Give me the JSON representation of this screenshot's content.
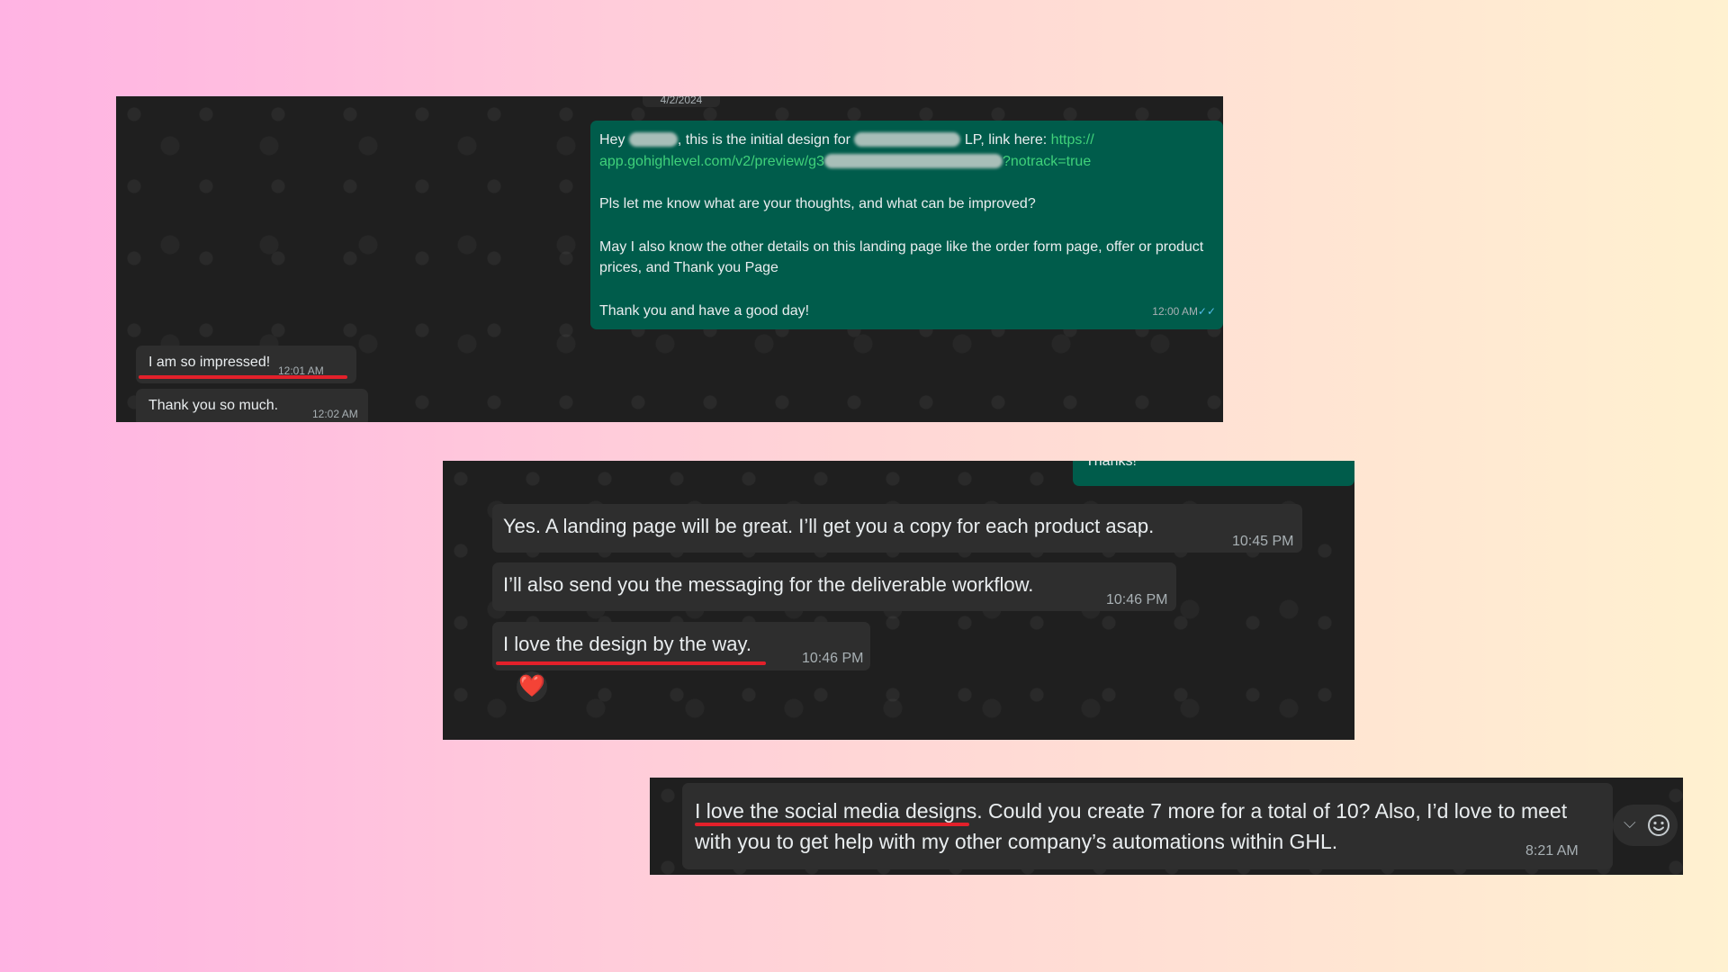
{
  "chat1": {
    "date": "4/2/2024",
    "outgoing": {
      "line1_prefix": "Hey ",
      "line1_mid": ", this is the initial design for ",
      "line1_suffix": " LP, link here: ",
      "link_start": "https://",
      "link_domain": "app.gohighlevel.com/v2/preview/g3",
      "link_end": "?notrack=true",
      "para2": "Pls let me know what are your thoughts, and what can be improved?",
      "para3": "May I also know the other details on this landing page like the order form page, offer or product prices, and Thank you Page",
      "para4": "Thank you and have a good day!",
      "time": "12:00 AM",
      "ticks": "✓✓"
    },
    "incoming": [
      {
        "text": "I am so impressed!",
        "time": "12:01 AM"
      },
      {
        "text": "Thank you so much.",
        "time": "12:02 AM"
      }
    ]
  },
  "chat2": {
    "partial_outgoing": "Thanks!",
    "incoming": [
      {
        "text": "Yes. A landing page will be great. I’ll get you a copy for each product asap.",
        "time": "10:45 PM"
      },
      {
        "text": "I’ll also send you the messaging for the deliverable workflow.",
        "time": "10:46 PM"
      },
      {
        "text": "I love the design by the way.",
        "time": "10:46 PM"
      }
    ],
    "reaction": "❤️"
  },
  "chat3": {
    "message": "I love the social media designs. Could you create 7 more for a total of 10? Also, I’d love to meet with you to get help with my other company’s automations within GHL.",
    "time": "8:21 AM",
    "icons": [
      "chevron-down-icon",
      "emoji-icon"
    ]
  },
  "colors": {
    "chat_bg": "#1f1f1f",
    "incoming_bubble": "#2e2e2e",
    "outgoing_bubble": "#005c4b",
    "underline": "#e3202a",
    "link": "#53bdeb"
  }
}
